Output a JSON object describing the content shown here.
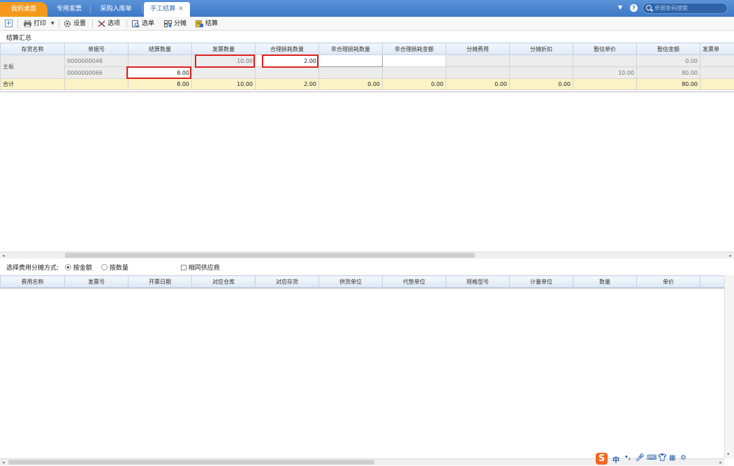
{
  "tabs": {
    "home": "我的桌面",
    "t1": "专用发票",
    "t2": "采购入库单",
    "active": "手工结算"
  },
  "search": {
    "placeholder": "单据条码搜索"
  },
  "toolbar": {
    "print": "打印",
    "settings": "设置",
    "options": "选项",
    "select": "选单",
    "allocate": "分摊",
    "settle": "结算"
  },
  "section_title": "结算汇总",
  "table1": {
    "headers": [
      "存货名称",
      "单据号",
      "结算数量",
      "发票数量",
      "合理损耗数量",
      "非合理损耗数量",
      "非合理损耗金额",
      "分摊费用",
      "分摊折扣",
      "暂估单价",
      "暂估金额",
      "发票单"
    ],
    "item_name": "主板",
    "row1": {
      "doc_no": "0000000048",
      "invoice_qty": "10.00",
      "reasonable_loss": "2.00",
      "est_amount": "0.00"
    },
    "row2": {
      "doc_no": "0000000066",
      "settle_qty": "8.00",
      "est_price": "10.00",
      "est_amount": "80.00"
    },
    "total": {
      "label": "合计",
      "settle_qty": "8.00",
      "invoice_qty": "10.00",
      "reasonable_loss": "2.00",
      "unreasonable_qty": "0.00",
      "unreasonable_amt": "0.00",
      "alloc_fee": "0.00",
      "alloc_disc": "0.00",
      "est_amount": "80.00"
    }
  },
  "alloc": {
    "label": "选择费用分摊方式:",
    "by_amount": "按金额",
    "by_qty": "按数量",
    "same_supplier": "相同供应商",
    "selected": "by_amount"
  },
  "table2": {
    "headers": [
      "费用名称",
      "发票号",
      "开票日期",
      "对应仓库",
      "对应存货",
      "供货单位",
      "代垫单位",
      "规格型号",
      "计量单位",
      "数量",
      "单价"
    ]
  },
  "ime": {
    "lang": "中"
  }
}
